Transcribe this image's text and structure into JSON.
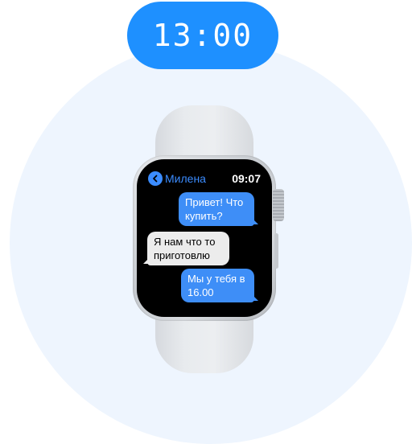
{
  "time_badge": "13:00",
  "watch": {
    "header": {
      "back_label": "Милена",
      "back_icon": "chevron-left-icon",
      "clock": "09:07"
    },
    "messages": [
      {
        "direction": "outgoing",
        "lines": [
          "Привет! Что",
          "купить?"
        ]
      },
      {
        "direction": "incoming",
        "lines": [
          "Я нам что то",
          "приготовлю"
        ]
      },
      {
        "direction": "outgoing",
        "lines": [
          "Мы у тебя в",
          "16.00"
        ]
      }
    ]
  },
  "colors": {
    "badge_bg": "#1e90ff",
    "outgoing_bubble": "#3e8ef7",
    "incoming_bubble": "#ececec",
    "background_circle": "#eef5fe"
  }
}
